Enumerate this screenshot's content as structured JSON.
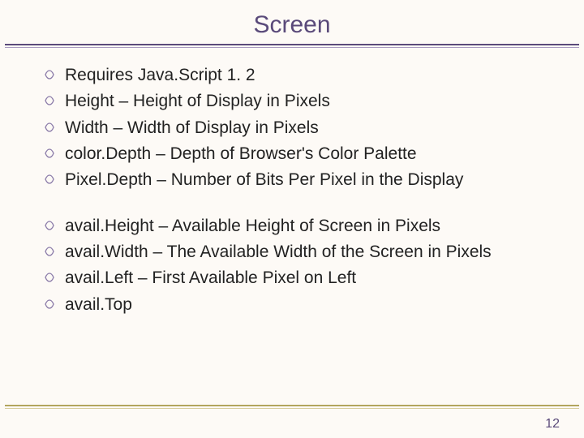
{
  "title": "Screen",
  "group1": [
    "Requires Java.Script 1. 2",
    "Height – Height of Display in Pixels",
    "Width – Width of Display in Pixels",
    "color.Depth – Depth of Browser's Color Palette",
    "Pixel.Depth – Number of Bits Per Pixel in the Display"
  ],
  "group2": [
    "avail.Height – Available Height of Screen in Pixels",
    "avail.Width – The Available Width of the Screen in Pixels",
    "avail.Left – First Available Pixel on Left",
    "avail.Top"
  ],
  "pagenum": "12"
}
